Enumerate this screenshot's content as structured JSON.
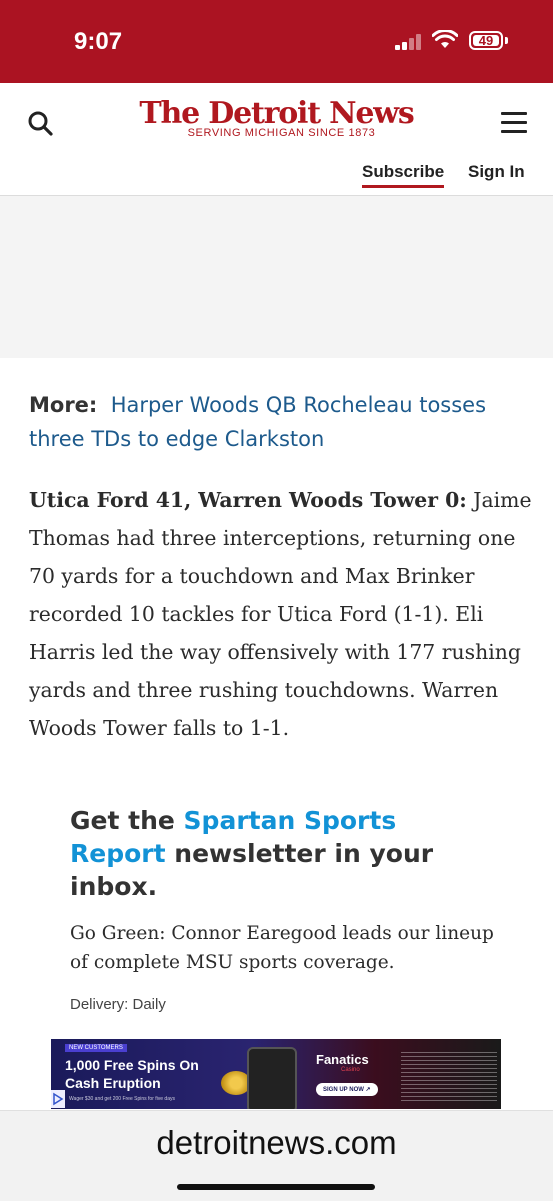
{
  "status_bar": {
    "time": "9:07",
    "battery": "49",
    "background": "#ab1322"
  },
  "header": {
    "logo_title": "The Detroit News",
    "logo_tagline": "SERVING MICHIGAN SINCE 1873",
    "subscribe": "Subscribe",
    "sign_in": "Sign In",
    "search_icon": "search-icon",
    "menu_icon": "hamburger-menu-icon",
    "brand_color": "#b0181f"
  },
  "more": {
    "label": "More:",
    "link": "Harper Woods QB Rocheleau tosses three TDs to edge Clarkston",
    "link_color": "#1d5a8c"
  },
  "article": {
    "lead": "Utica Ford 41, Warren Woods Tower 0:",
    "body": " Jaime Thomas had three interceptions, returning one 70 yards for a touchdown and Max Brinker recorded 10 tackles for Utica Ford (1-1). Eli Harris led the way offensively with 177 rushing yards and three rushing touchdowns. Warren Woods Tower falls to 1-1."
  },
  "newsletter": {
    "prefix": "Get the ",
    "highlight": "Spartan Sports Report",
    "suffix": " newsletter in your inbox.",
    "description": "Go Green: Connor Earegood leads our lineup of complete MSU sports coverage.",
    "delivery": "Delivery: Daily",
    "highlight_color": "#1292d6"
  },
  "ad": {
    "badge": "NEW CUSTOMERS",
    "headline_1": "1,000 Free Spins On",
    "headline_2": "Cash Eruption",
    "fine_print": "Wager $30 and get 200 Free Spins for five days",
    "brand": "Fanatics",
    "brand_sub": "Casino",
    "cta": "SIGN UP NOW ↗"
  },
  "browser": {
    "url": "detroitnews.com"
  }
}
